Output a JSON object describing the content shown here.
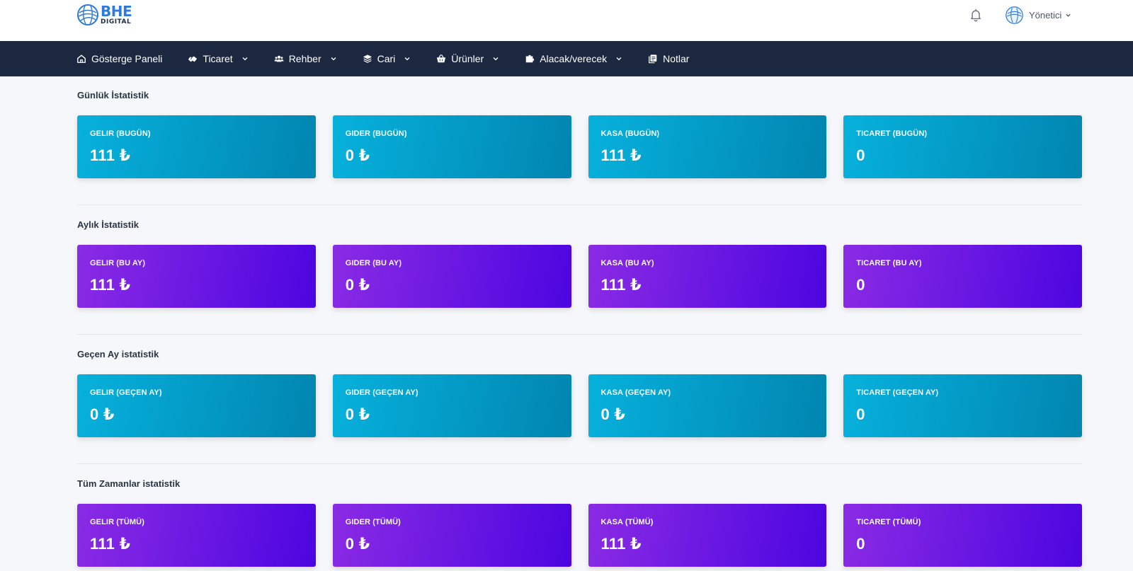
{
  "brand": {
    "title": "BHE",
    "subtitle": "DIGITAL"
  },
  "header": {
    "user_name": "Yönetici"
  },
  "nav": [
    {
      "label": "Gösterge Paneli",
      "icon": "home-icon",
      "dropdown": false
    },
    {
      "label": "Ticaret",
      "icon": "handshake-icon",
      "dropdown": true
    },
    {
      "label": "Rehber",
      "icon": "users-icon",
      "dropdown": true
    },
    {
      "label": "Cari",
      "icon": "layers-icon",
      "dropdown": true
    },
    {
      "label": "Ürünler",
      "icon": "basket-icon",
      "dropdown": true
    },
    {
      "label": "Alacak/verecek",
      "icon": "puzzle-icon",
      "dropdown": true
    },
    {
      "label": "Notlar",
      "icon": "notes-icon",
      "dropdown": false
    }
  ],
  "sections": [
    {
      "title": "Günlük İstatistik",
      "theme": "cyan",
      "cards": [
        {
          "label": "GELIR (BUGÜN)",
          "value": "111 ₺"
        },
        {
          "label": "GIDER (BUGÜN)",
          "value": "0 ₺"
        },
        {
          "label": "KASA (BUGÜN)",
          "value": "111 ₺"
        },
        {
          "label": "TICARET (BUGÜN)",
          "value": "0"
        }
      ]
    },
    {
      "title": "Aylık İstatistik",
      "theme": "purple",
      "cards": [
        {
          "label": "GELIR (BU AY)",
          "value": "111 ₺"
        },
        {
          "label": "GIDER (BU AY)",
          "value": "0 ₺"
        },
        {
          "label": "KASA (BU AY)",
          "value": "111 ₺"
        },
        {
          "label": "TICARET (BU AY)",
          "value": "0"
        }
      ]
    },
    {
      "title": "Geçen Ay istatistik",
      "theme": "cyan",
      "cards": [
        {
          "label": "GELIR (GEÇEN AY)",
          "value": "0 ₺"
        },
        {
          "label": "GIDER (GEÇEN AY)",
          "value": "0 ₺"
        },
        {
          "label": "KASA (GEÇEN AY)",
          "value": "0 ₺"
        },
        {
          "label": "TICARET (GEÇEN AY)",
          "value": "0"
        }
      ]
    },
    {
      "title": "Tüm Zamanlar istatistik",
      "theme": "purple",
      "cards": [
        {
          "label": "GELIR (TÜMÜ)",
          "value": "111 ₺"
        },
        {
          "label": "GIDER (TÜMÜ)",
          "value": "0 ₺"
        },
        {
          "label": "KASA (TÜMÜ)",
          "value": "111 ₺"
        },
        {
          "label": "TICARET (TÜMÜ)",
          "value": "0"
        }
      ]
    }
  ],
  "colors": {
    "navbar": "#1c2840",
    "cyan_start": "#06b1dc",
    "cyan_end": "#0085b0",
    "purple_start": "#8a2be4",
    "purple_end": "#4c05e0",
    "brand": "#2f7ad8"
  }
}
